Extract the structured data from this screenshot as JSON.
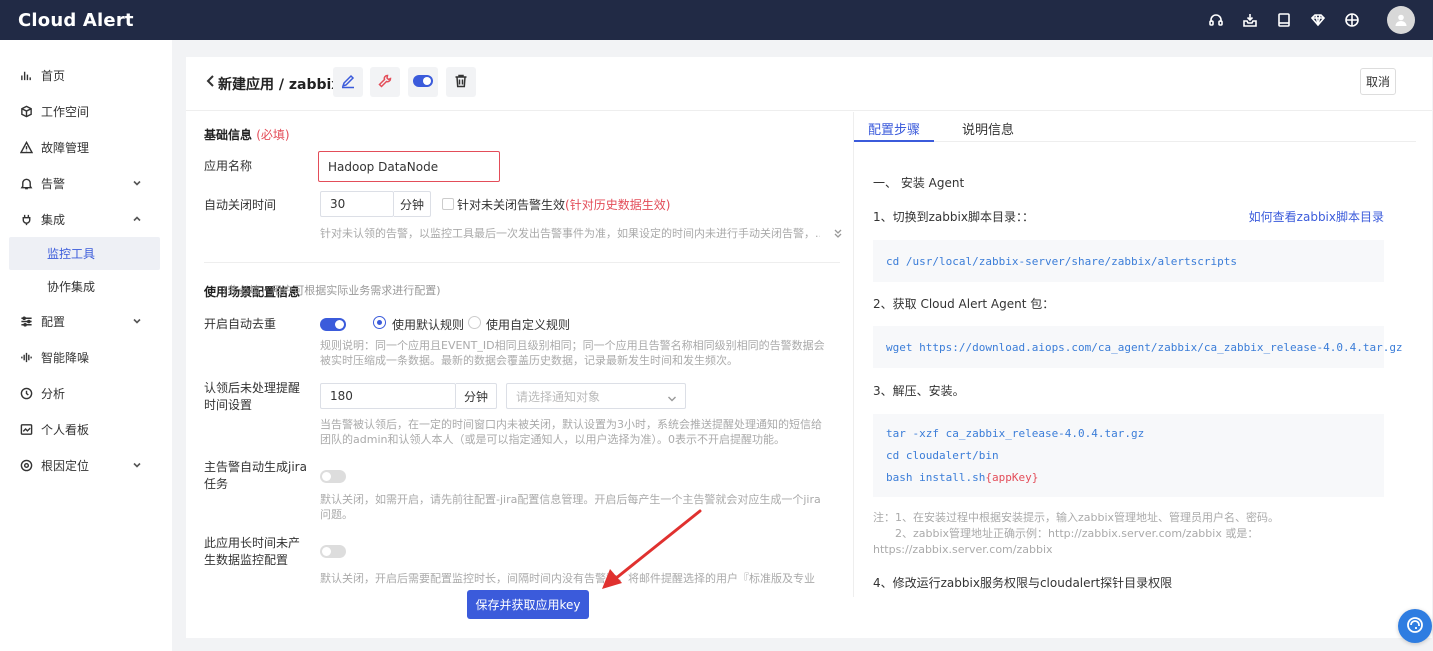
{
  "app": {
    "brand": "Cloud Alert"
  },
  "topbar_icons": [
    "headset-icon",
    "download-box-icon",
    "book-icon",
    "diamond-icon",
    "globe-icon",
    "user-avatar-icon"
  ],
  "sidebar": {
    "items": [
      {
        "label": "首页",
        "icon": "bar-chart-icon"
      },
      {
        "label": "工作空间",
        "icon": "cube-icon"
      },
      {
        "label": "故障管理",
        "icon": "warning-icon"
      },
      {
        "label": "告警",
        "icon": "bell-icon",
        "expandable": true
      },
      {
        "label": "集成",
        "icon": "plug-icon",
        "expanded": true
      },
      {
        "label": "配置",
        "icon": "sliders-icon",
        "expandable": true
      },
      {
        "label": "智能降噪",
        "icon": "waveform-icon"
      },
      {
        "label": "分析",
        "icon": "clock-icon"
      },
      {
        "label": "个人看板",
        "icon": "chart-board-icon"
      },
      {
        "label": "根因定位",
        "icon": "target-icon",
        "expandable": true
      }
    ],
    "sub_items": [
      {
        "label": "监控工具",
        "active": true
      },
      {
        "label": "协作集成",
        "active": false
      }
    ]
  },
  "header": {
    "title": "新建应用 / zabbix",
    "cancel_label": "取消",
    "toggle_on": true
  },
  "form": {
    "basic": {
      "title": "基础信息",
      "required": "(必填)",
      "app_name_label": "应用名称",
      "app_name_value": "Hadoop DataNode",
      "auto_close_label": "自动关闭时间",
      "auto_close_value": "30",
      "auto_close_unit": "分钟",
      "unclosed_label": "针对未关闭告警生效",
      "unclosed_warn": "(针对历史数据生效)",
      "auto_close_help": "针对未认领的告警，以监控工具最后一次发出告警事件为准，如果设定的时间内未进行手动关闭告警，..."
    },
    "scene": {
      "title": "使用场景配置信息",
      "note": "(非必填，用户可根据实际业务需求进行配置)",
      "dedup_label": "开启自动去重",
      "dedup_default": "使用默认规则",
      "dedup_custom": "使用自定义规则",
      "dedup_help": "规则说明：同一个应用且EVENT_ID相同且级别相同；同一个应用且告警名称相同级别相同的告警数据会被实时压缩成一条数据。最新的数据会覆盖历史数据，记录最新发生时间和发生频次。",
      "remind_label": "认领后未处理提醒时间设置",
      "remind_value": "180",
      "remind_unit": "分钟",
      "remind_select_placeholder": "请选择通知对象",
      "remind_help": "当告警被认领后，在一定的时间窗口内未被关闭，默认设置为3小时，系统会推送提醒处理通知的短信给团队的admin和认领人本人（或是可以指定通知人，以用户选择为准）。0表示不开启提醒功能。",
      "jira_label": "主告警自动生成jira任务",
      "jira_help": "默认关闭，如需开启，请先前往配置-jira配置信息管理。开启后每产生一个主告警就会对应生成一个jira问题。",
      "nodata_label": "此应用长时间未产生数据监控配置",
      "nodata_help": "默认关闭，开启后需要配置监控时长，间隔时间内没有告警数，将邮件提醒选择的用户『标准版及专业"
    },
    "save_label": "保存并获取应用key"
  },
  "guide": {
    "tabs": [
      "配置步骤",
      "说明信息"
    ],
    "active_tab": 0,
    "step1_title": "一、 安装 Agent",
    "step1_1": "1、切换到zabbix脚本目录：：",
    "step1_1_link": "如何查看zabbix脚本目录",
    "code1": "cd /usr/local/zabbix-server/share/zabbix/alertscripts",
    "step1_2": "2、获取 Cloud Alert Agent 包：",
    "code2": "wget https://download.aiops.com/ca_agent/zabbix/ca_zabbix_release-4.0.4.tar.gz",
    "step1_3": "3、解压、安装。",
    "code3": [
      "tar -xzf ca_zabbix_release-4.0.4.tar.gz",
      "cd cloudalert/bin"
    ],
    "code3_last_prefix": "bash install.sh ",
    "code3_last_key": "{appKey}",
    "note_line1": "注：1、在安装过程中根据安装提示，输入zabbix管理地址、管理员用户名、密码。",
    "note_line2": "2、zabbix管理地址正确示例：http://zabbix.server.com/zabbix 或是：",
    "note_line3": "https://zabbix.server.com/zabbix",
    "step1_4": "4、修改运行zabbix服务权限与cloudalert探针目录权限"
  }
}
